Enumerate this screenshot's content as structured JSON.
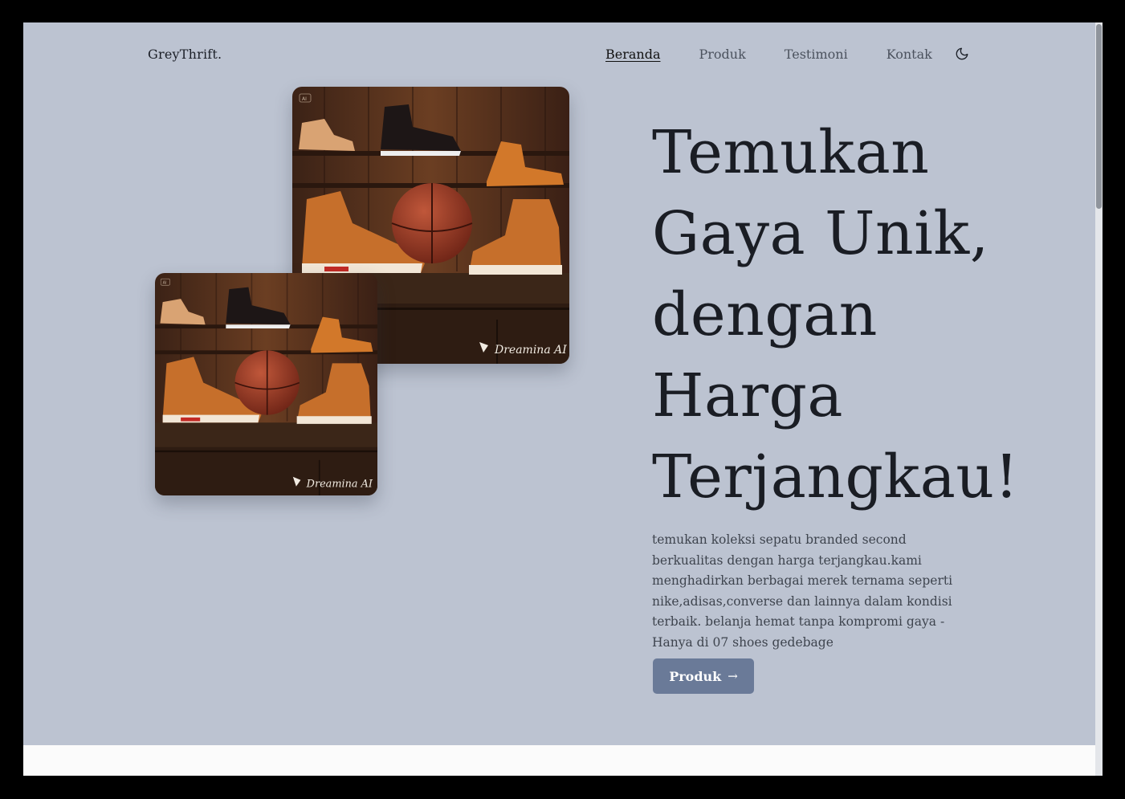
{
  "brand": "GreyThrift.",
  "nav": {
    "items": [
      "Beranda",
      "Produk",
      "Testimoni",
      "Kontak"
    ],
    "active": "Beranda",
    "theme_toggle_icon": "moon-icon"
  },
  "hero": {
    "headline": "Temukan Gaya Unik, dengan Harga Terjangkau!",
    "description": "temukan koleksi sepatu branded second berkualitas dengan harga terjangkau.kami menghadirkan berbagai merek ternama seperti nike,adisas,converse dan lainnya dalam kondisi terbaik. belanja hemat tanpa kompromi gaya - Hanya di 07 shoes gedebage",
    "cta_label": "Produk",
    "cta_icon": "arrow-right-icon"
  },
  "images": {
    "badge": "AI",
    "watermark": "Dreamina AI"
  },
  "colors": {
    "hero_bg": "#bcc3d1",
    "button_bg": "#6a7a98",
    "text_dark": "#1a1d24"
  }
}
